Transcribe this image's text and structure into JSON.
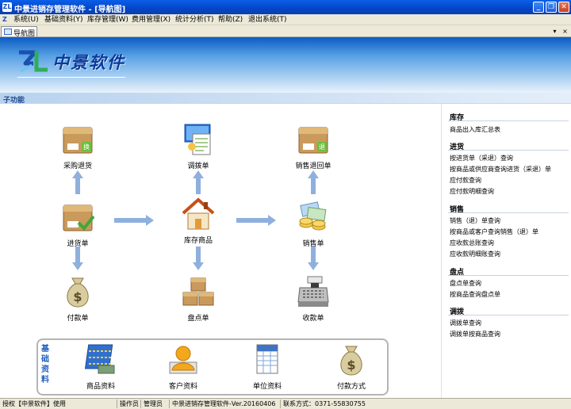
{
  "window": {
    "title": "中景进销存管理软件 - [导航图]"
  },
  "menu": [
    "系统(U)",
    "基础资料(Y)",
    "库存管理(W)",
    "费用管理(X)",
    "统计分析(T)",
    "帮助(Z)",
    "退出系统(T)"
  ],
  "tab": {
    "label": "导航图",
    "close": "×",
    "dropdown": "▾"
  },
  "banner": {
    "logo_text": "中景软件"
  },
  "section": {
    "label": "子功能"
  },
  "flow": {
    "purchase_return": "采购退货",
    "transfer": "调拨单",
    "sales_return": "销售退回单",
    "purchase": "进货单",
    "inventory": "库存商品",
    "sales": "销售单",
    "payment": "付款单",
    "stocktake": "盘点单",
    "receipt": "收款单"
  },
  "basic": {
    "title": "基础资料",
    "items": [
      "商品资料",
      "客户资料",
      "单位资料",
      "付款方式"
    ]
  },
  "right_panel": {
    "groups": [
      {
        "title": "库存",
        "items": [
          "商品出入库汇总表"
        ]
      },
      {
        "title": "进货",
        "items": [
          "按进货单（采退）查询",
          "按商品或供应商查询进货（采退）单",
          "应付款查询",
          "应付款明细查询"
        ]
      },
      {
        "title": "销售",
        "items": [
          "销售（退）单查询",
          "按商品或客户查询销售（退）单",
          "应收款总账查询",
          "应收款明细账查询"
        ]
      },
      {
        "title": "盘点",
        "items": [
          "盘点单查询",
          "按商品查询盘点单"
        ]
      },
      {
        "title": "调拨",
        "items": [
          "调拨单查询",
          "调拨单按商品查询"
        ]
      }
    ]
  },
  "status": {
    "license": "授权【中景软件】使用",
    "operator_label": "操作员",
    "operator": "管理员",
    "version": "中景进销存管理软件-Ver.20160406",
    "contact": "联系方式：0371-55830755"
  },
  "colors": {
    "titlebar": "#0645c8",
    "accent": "#1d4b8f",
    "arrow": "#8fb0dd"
  }
}
